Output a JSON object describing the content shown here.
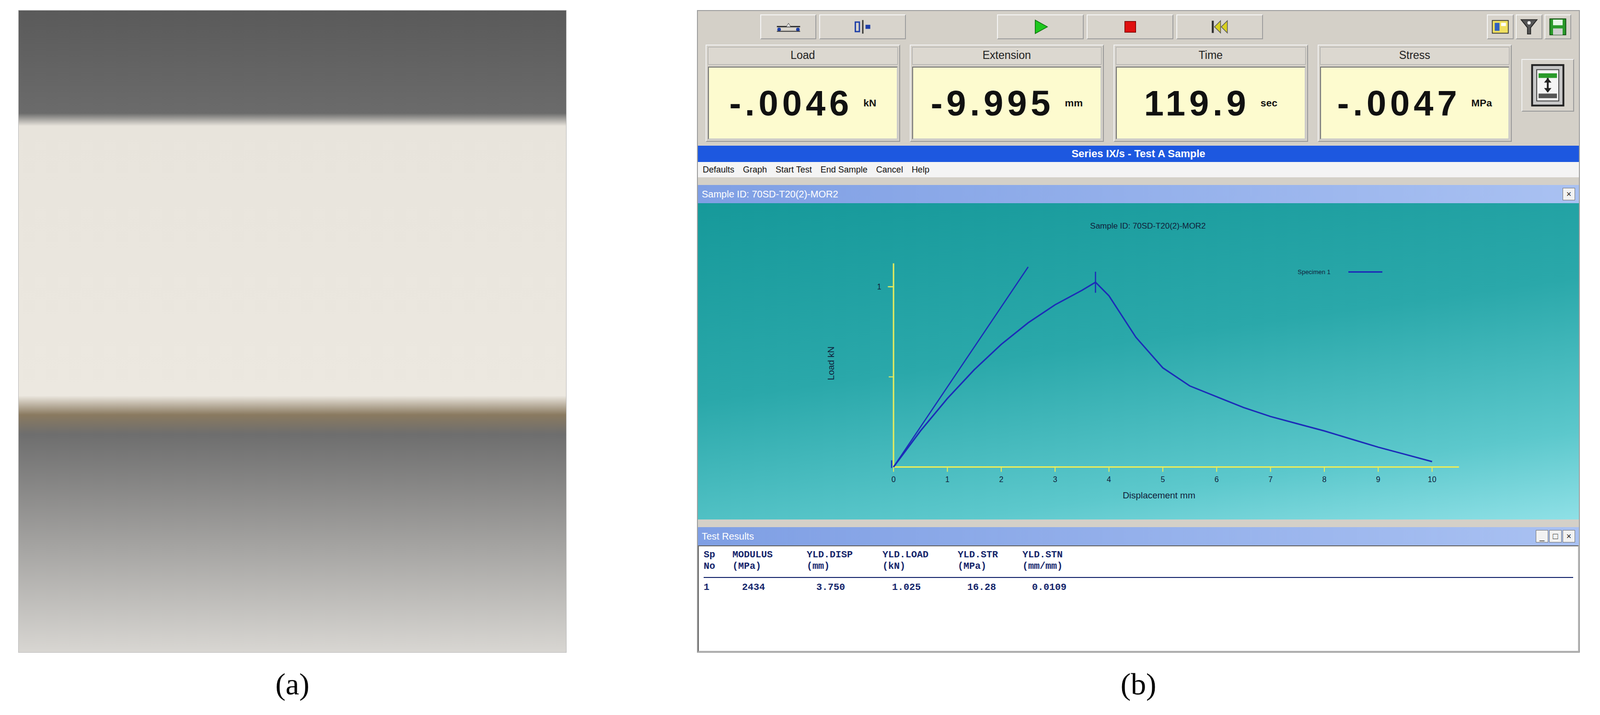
{
  "figure": {
    "labels": [
      "(a)",
      "(b)"
    ]
  },
  "readouts": [
    {
      "label": "Load",
      "value": "-.0046",
      "unit": "kN"
    },
    {
      "label": "Extension",
      "value": "-9.995",
      "unit": "mm"
    },
    {
      "label": "Time",
      "value": "119.9",
      "unit": "sec"
    },
    {
      "label": "Stress",
      "value": "-.0047",
      "unit": "MPa"
    }
  ],
  "window": {
    "title": "Series IX/s - Test A Sample"
  },
  "menu": [
    "Defaults",
    "Graph",
    "Start Test",
    "End Sample",
    "Cancel",
    "Help"
  ],
  "sample_panel": {
    "title": "Sample ID: 70SD-T20(2)-MOR2",
    "close": "×"
  },
  "chart": {
    "title": "Sample ID: 70SD-T20(2)-MOR2",
    "x_label": "Displacement mm",
    "y_label": "Load kN",
    "x_ticks": [
      "0",
      "1",
      "2",
      "3",
      "4",
      "5",
      "6",
      "7",
      "8",
      "9",
      "10"
    ],
    "y_ticks": [
      "1"
    ],
    "legend": "Specimen 1",
    "series": [
      {
        "name": "Specimen 1",
        "x": [
          0,
          0.5,
          1,
          1.5,
          2,
          2.5,
          3,
          3.5,
          3.75,
          4,
          4.5,
          5,
          5.5,
          6,
          6.5,
          7,
          7.5,
          8,
          8.5,
          9,
          9.5,
          10
        ],
        "y": [
          0,
          0.2,
          0.38,
          0.54,
          0.68,
          0.8,
          0.9,
          0.98,
          1.025,
          0.95,
          0.72,
          0.55,
          0.45,
          0.39,
          0.33,
          0.28,
          0.24,
          0.2,
          0.155,
          0.11,
          0.07,
          0.03
        ]
      }
    ],
    "tangent": {
      "x": [
        0,
        2.5
      ],
      "y": [
        0,
        1.11
      ]
    },
    "yield_marker": {
      "x": 3.75,
      "y": 1.025
    }
  },
  "results": {
    "title": "Test Results",
    "controls": [
      "_",
      "□",
      "×"
    ],
    "columns": [
      {
        "top": "Sp",
        "bottom": "No"
      },
      {
        "top": "MODULUS",
        "bottom": "(MPa)"
      },
      {
        "top": "YLD.DISP",
        "bottom": "(mm)"
      },
      {
        "top": "YLD.LOAD",
        "bottom": "(kN)"
      },
      {
        "top": "YLD.STR",
        "bottom": "(MPa)"
      },
      {
        "top": "YLD.STN",
        "bottom": "(mm/mm)"
      }
    ],
    "rows": [
      [
        "1",
        "2434",
        "3.750",
        "1.025",
        "16.28",
        "0.0109"
      ]
    ]
  }
}
